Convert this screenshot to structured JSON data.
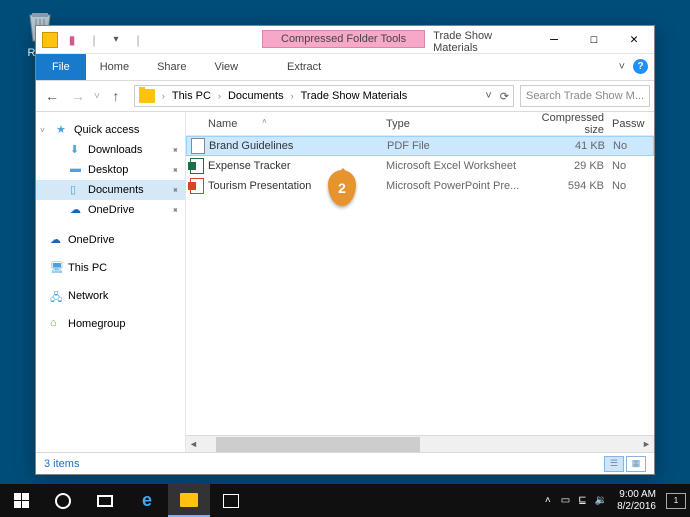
{
  "desktop": {
    "recycle_bin": "Recy"
  },
  "window": {
    "compressed_tools": "Compressed Folder Tools",
    "title": "Trade Show Materials",
    "tabs": {
      "file": "File",
      "home": "Home",
      "share": "Share",
      "view": "View",
      "extract": "Extract"
    },
    "help_caret": "˅"
  },
  "nav": {
    "back": "←",
    "forward": "→",
    "up": "↑",
    "crumbs": [
      "This PC",
      "Documents",
      "Trade Show Materials"
    ],
    "dropdown": "˅",
    "refresh": "⟳",
    "search_placeholder": "Search Trade Show M..."
  },
  "sidebar": {
    "quick_access": "Quick access",
    "items": [
      {
        "label": "Downloads",
        "pinned": true
      },
      {
        "label": "Desktop",
        "pinned": true
      },
      {
        "label": "Documents",
        "pinned": true,
        "selected": true
      },
      {
        "label": "OneDrive",
        "pinned": true
      }
    ],
    "groups": [
      "OneDrive",
      "This PC",
      "Network",
      "Homegroup"
    ]
  },
  "columns": {
    "name": "Name",
    "type": "Type",
    "size": "Compressed size",
    "pass": "Passw"
  },
  "files": [
    {
      "name": "Brand Guidelines",
      "type": "PDF File",
      "size": "41 KB",
      "pass": "No",
      "icon": "pdf",
      "selected": true
    },
    {
      "name": "Expense Tracker",
      "type": "Microsoft Excel Worksheet",
      "size": "29 KB",
      "pass": "No",
      "icon": "xl"
    },
    {
      "name": "Tourism Presentation",
      "type": "Microsoft PowerPoint Pre...",
      "size": "594 KB",
      "pass": "No",
      "icon": "pp"
    }
  ],
  "callout": "2",
  "status": {
    "items": "3 items"
  },
  "taskbar": {
    "tray_up": "˄",
    "time": "9:00 AM",
    "date": "8/2/2016",
    "notif_count": "1"
  }
}
